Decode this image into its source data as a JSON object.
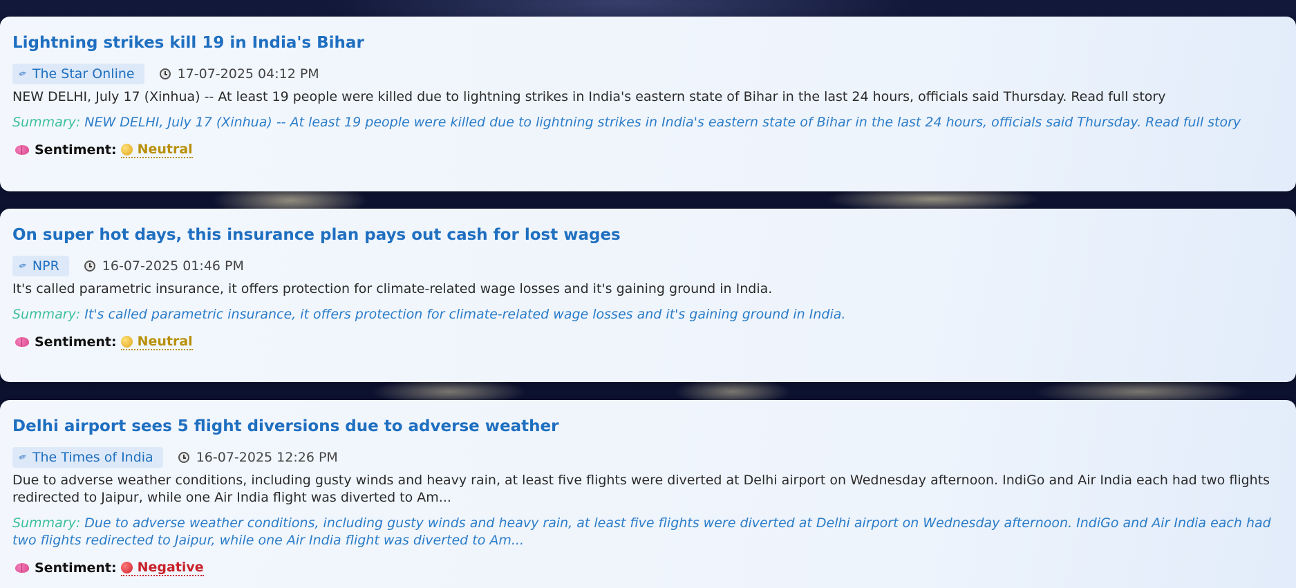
{
  "articles": [
    {
      "title": "Lightning strikes kill 19 in India's Bihar",
      "source": "The Star Online",
      "timestamp": "17-07-2025 04:12 PM",
      "description": "NEW DELHI, July 17 (Xinhua) -- At least 19 people were killed due to lightning strikes in India's eastern state of Bihar in the last 24 hours, officials said Thursday. Read full story",
      "summary_label": "Summary:",
      "summary": "NEW DELHI, July 17 (Xinhua) -- At least 19 people were killed due to lightning strikes in India's eastern state of Bihar in the last 24 hours, officials said Thursday. Read full story",
      "sentiment_label": "Sentiment:",
      "sentiment": "Neutral"
    },
    {
      "title": "On super hot days, this insurance plan pays out cash for lost wages",
      "source": "NPR",
      "timestamp": "16-07-2025 01:46 PM",
      "description": "It's called parametric insurance, it offers protection for climate-related wage losses and it's gaining ground in India.",
      "summary_label": "Summary:",
      "summary": "It's called parametric insurance, it offers protection for climate-related wage losses and it's gaining ground in India.",
      "sentiment_label": "Sentiment:",
      "sentiment": "Neutral"
    },
    {
      "title": "Delhi airport sees 5 flight diversions due to adverse weather",
      "source": "The Times of India",
      "timestamp": "16-07-2025 12:26 PM",
      "description": "Due to adverse weather conditions, including gusty winds and heavy rain, at least five flights were diverted at Delhi airport on Wednesday afternoon. IndiGo and Air India each had two flights redirected to Jaipur, while one Air India flight was diverted to Am...",
      "summary_label": "Summary:",
      "summary": "Due to adverse weather conditions, including gusty winds and heavy rain, at least five flights were diverted at Delhi airport on Wednesday afternoon. IndiGo and Air India each had two flights redirected to Jaipur, while one Air India flight was diverted to Am...",
      "sentiment_label": "Sentiment:",
      "sentiment": "Negative"
    }
  ],
  "icons": {
    "source": "pin-icon",
    "time": "clock-icon",
    "sentiment": "brain-icon",
    "neutral": "yellow-circle-icon",
    "negative": "red-circle-icon"
  },
  "colors": {
    "title": "#1f6fc0",
    "summary_label": "#3bbf9f",
    "summary_text": "#2a7cc8",
    "neutral": "#b8900a",
    "negative": "#c8222a"
  }
}
